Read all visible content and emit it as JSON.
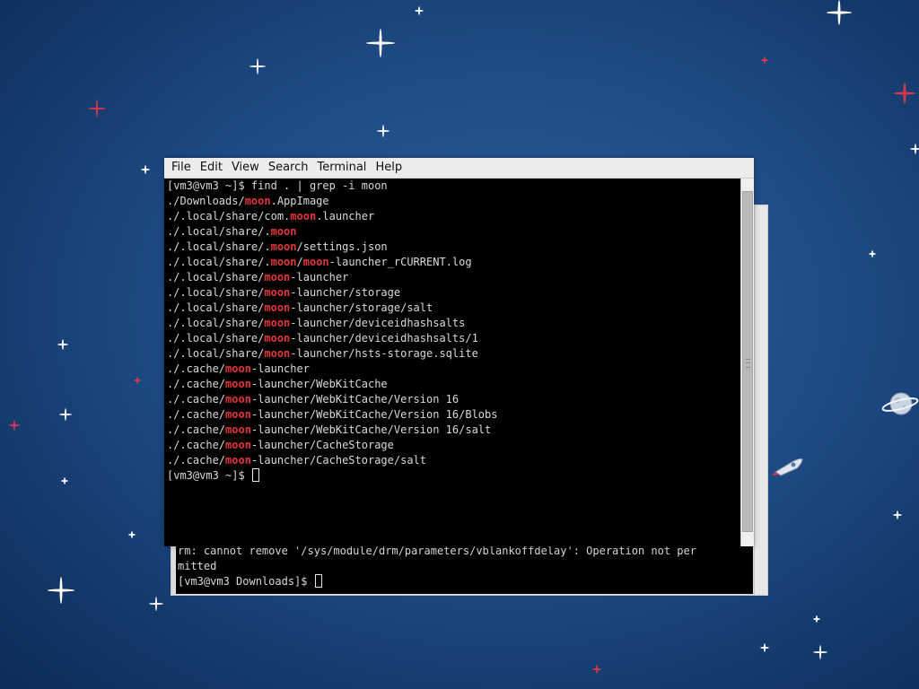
{
  "desktop": {
    "background_color": "#1f4c86",
    "star_color": "#ffffff",
    "red_star_color": "#e0364a",
    "icons": [
      "planet-icon",
      "rocket-icon"
    ]
  },
  "front_terminal": {
    "menu": [
      "File",
      "Edit",
      "View",
      "Search",
      "Terminal",
      "Help"
    ],
    "prompt": "[vm3@vm3 ~]$ ",
    "command": "find . | grep -i moon",
    "highlight_color": "#e33636",
    "lines": [
      {
        "pre": "./Downloads/",
        "hl": "moon",
        "post": ".AppImage"
      },
      {
        "pre": "./.local/share/com.",
        "hl": "moon",
        "post": ".launcher"
      },
      {
        "pre": "./.local/share/.",
        "hl": "moon",
        "post": ""
      },
      {
        "pre": "./.local/share/.",
        "hl": "moon",
        "post": "/settings.json"
      },
      {
        "pre": "./.local/share/.",
        "hl": "moon",
        "post": "/",
        "hl2": "moon",
        "post2": "-launcher_rCURRENT.log"
      },
      {
        "pre": "./.local/share/",
        "hl": "moon",
        "post": "-launcher"
      },
      {
        "pre": "./.local/share/",
        "hl": "moon",
        "post": "-launcher/storage"
      },
      {
        "pre": "./.local/share/",
        "hl": "moon",
        "post": "-launcher/storage/salt"
      },
      {
        "pre": "./.local/share/",
        "hl": "moon",
        "post": "-launcher/deviceidhashsalts"
      },
      {
        "pre": "./.local/share/",
        "hl": "moon",
        "post": "-launcher/deviceidhashsalts/1"
      },
      {
        "pre": "./.local/share/",
        "hl": "moon",
        "post": "-launcher/hsts-storage.sqlite"
      },
      {
        "pre": "./.cache/",
        "hl": "moon",
        "post": "-launcher"
      },
      {
        "pre": "./.cache/",
        "hl": "moon",
        "post": "-launcher/WebKitCache"
      },
      {
        "pre": "./.cache/",
        "hl": "moon",
        "post": "-launcher/WebKitCache/Version 16"
      },
      {
        "pre": "./.cache/",
        "hl": "moon",
        "post": "-launcher/WebKitCache/Version 16/Blobs"
      },
      {
        "pre": "./.cache/",
        "hl": "moon",
        "post": "-launcher/WebKitCache/Version 16/salt"
      },
      {
        "pre": "./.cache/",
        "hl": "moon",
        "post": "-launcher/CacheStorage"
      },
      {
        "pre": "./.cache/",
        "hl": "moon",
        "post": "-launcher/CacheStorage/salt"
      }
    ],
    "final_prompt": "[vm3@vm3 ~]$ "
  },
  "back_terminal": {
    "lines": [
      "rm: cannot remove '/sys/module/drm/parameters/vblankoffdelay': Operation not per",
      "mitted"
    ],
    "prompt": "[vm3@vm3 Downloads]$ "
  }
}
